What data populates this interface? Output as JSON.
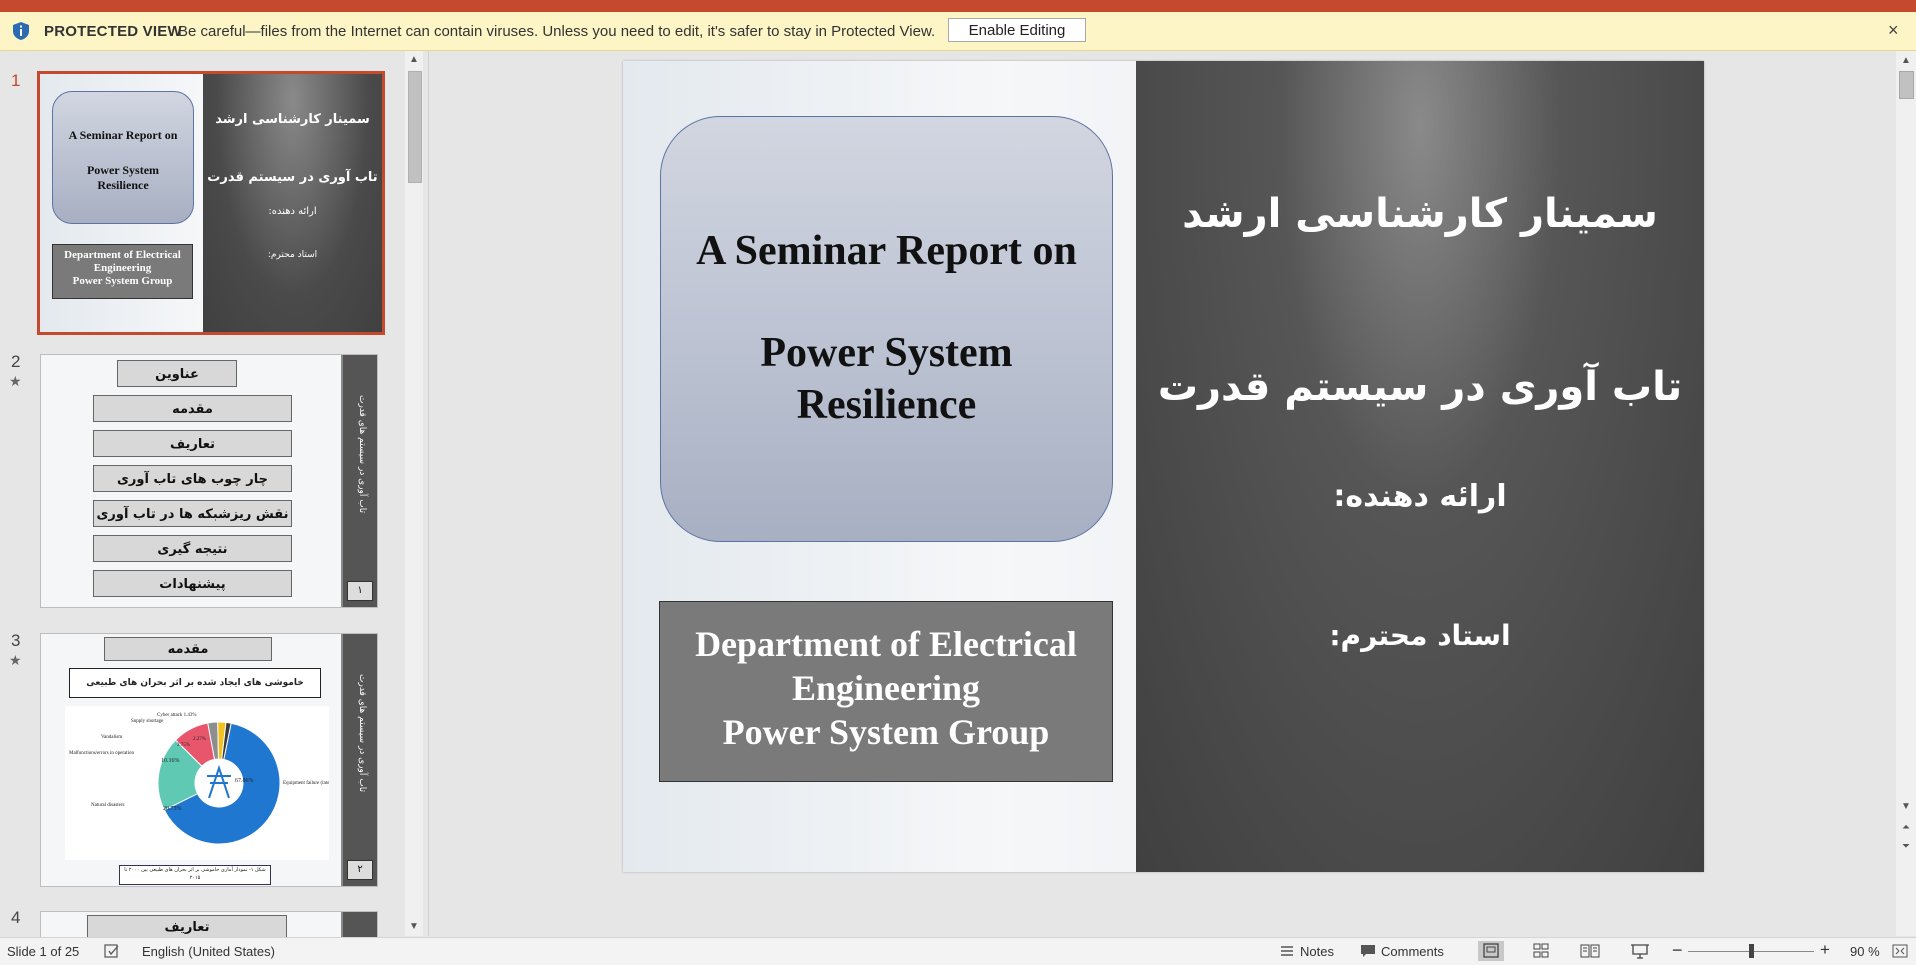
{
  "protected_view": {
    "title": "PROTECTED VIEW",
    "message": "Be careful—files from the Internet can contain viruses. Unless you need to edit, it's safer to stay in Protected View.",
    "enable_button": "Enable Editing",
    "close": "×",
    "icon": "shield-info-icon"
  },
  "thumbnails": [
    {
      "number": "1",
      "star": ""
    },
    {
      "number": "2",
      "star": "★"
    },
    {
      "number": "3",
      "star": "★"
    },
    {
      "number": "4",
      "star": ""
    }
  ],
  "thumb1": {
    "rbox_line1": "A Seminar Report on",
    "rbox_line2": "Power System Resilience",
    "dbox_line1": "Department of Electrical",
    "dbox_line2": "Engineering",
    "dbox_line3": "Power System Group",
    "fa1": "سمینار کارشناسی ارشد",
    "fa2": "تاب آوری در سیستم قدرت",
    "fa3": "ارائه دهنده:",
    "fa4": "استاد محترم:"
  },
  "thumb2": {
    "menu": [
      "عناوین",
      "مقدمه",
      "تعاریف",
      "چار چوب های تاب آوری",
      "نقش ریزشبکه ها در تاب آوری",
      "نتیجه گیری",
      "پیشنهادات"
    ],
    "side_text": "تاب آوری در سیستم های قدرت",
    "page": "۱"
  },
  "thumb3": {
    "header": "مقدمه",
    "subtitle": "خاموشی های ایجاد شده بر اثر بحران های طبیعی",
    "side_text": "تاب آوری در سیستم های قدرت",
    "page": "۲",
    "caption": "شکل ۱- نمودار آماری خاموشی بر اثر بحران های طبیعی بین ۲۰۰۰ تا ۲۰۱۵"
  },
  "chart_data": {
    "type": "pie",
    "title": "",
    "slices": [
      {
        "label": "Equipment failure (internal cause)",
        "value": 67.86,
        "color": "#1f77d0"
      },
      {
        "label": "Natural disasters",
        "value": 20.73,
        "color": "#5fc9b4"
      },
      {
        "label": "Malfunctions/errors in operation",
        "value": 10.16,
        "color": "#e8566c"
      },
      {
        "label": "Vandalism",
        "value": 2.75,
        "color": "#8e8e8e"
      },
      {
        "label": "Supply shortage",
        "value": 2.27,
        "color": "#f2c21f"
      },
      {
        "label": "Cyber attack",
        "value": 1.43,
        "color": "#3a3a3a"
      }
    ],
    "labels_shown": [
      "Cyber attack 1.43%",
      "Supply shortage",
      "Vandalism",
      "Malfunctions/errors in operation",
      "Natural disasters",
      "Equipment failure (internal cause)",
      "67.86%",
      "20.73%",
      "10.16%",
      "2.75%",
      "2.27%"
    ]
  },
  "thumb4": {
    "header": "تعاریف"
  },
  "slide": {
    "rbox_line1": "A Seminar Report on",
    "rbox_line2": "Power System",
    "rbox_line3": "Resilience",
    "dbox_line1": "Department of Electrical",
    "dbox_line2": "Engineering",
    "dbox_line3": "Power System Group",
    "fa1": "سمینار کارشناسی ارشد",
    "fa2": "تاب آوری در سیستم قدرت",
    "fa3": "ارائه دهنده:",
    "fa4": "استاد محترم:"
  },
  "status": {
    "slide_count": "Slide 1 of 25",
    "language": "English (United States)",
    "notes": "Notes",
    "comments": "Comments",
    "zoom_minus": "−",
    "zoom_plus": "+",
    "zoom_level": "90 %",
    "zoom_fraction": 0.5
  }
}
